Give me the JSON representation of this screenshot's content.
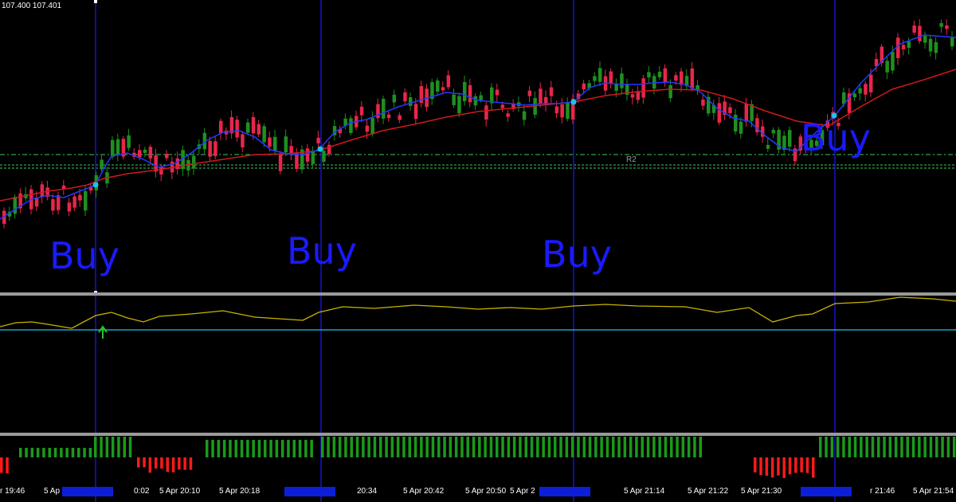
{
  "price_header": "107.400 107.401",
  "pivot_label": "R2",
  "signals": [
    "Buy",
    "Buy",
    "Buy",
    "Buy"
  ],
  "time_axis": [
    "r 19:46",
    "5 Ap",
    "0:02",
    "5 Apr 20:10",
    "5 Apr 20:18",
    "20:34",
    "5 Apr 20:42",
    "5 Apr 20:50",
    "5 Apr 2",
    "5 Apr 21:14",
    "5 Apr 21:22",
    "5 Apr 21:30",
    "r 21:46",
    "5 Apr 21:54"
  ],
  "colors": {
    "background": "#000000",
    "bull_candle": "#1f8f1f",
    "bear_candle": "#e8264a",
    "fast_ma": "#1f3bff",
    "slow_ma": "#cc1a1a",
    "signal_line": "#1515c8",
    "oscillator": "#c8b400",
    "level_line": "#19a3c7",
    "pivot_line": "#2fa04a",
    "hist_pos": "#1a9a1a",
    "hist_neg": "#ff1a1a",
    "selection_box": "#0c1fd6"
  },
  "icons": {
    "buy_arrow": "green-up-arrow-icon"
  }
}
